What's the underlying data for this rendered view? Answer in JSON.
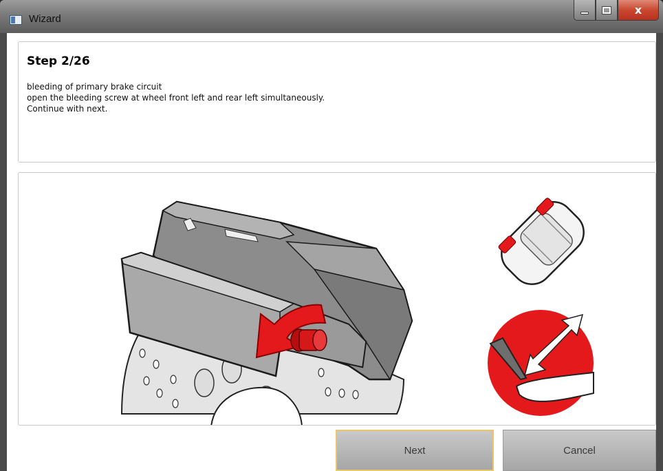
{
  "window": {
    "title": "Wizard",
    "close_glyph": "x",
    "icons": [
      "app-icon",
      "minimize-icon",
      "maximize-icon",
      "close-icon"
    ]
  },
  "step": {
    "title": "Step 2/26",
    "lines": [
      "bleeding of primary brake circuit",
      "open the bleeding screw at wheel front left and rear left simultaneously.",
      "Continue with next."
    ]
  },
  "illustration": {
    "items": [
      "brake-caliper",
      "brake-disc",
      "bleeding-screw",
      "rotate-arrow",
      "car-top-view",
      "pedal-icon"
    ],
    "highlight_color": "#e3191b"
  },
  "buttons": {
    "next_label": "Next",
    "cancel_label": "Cancel"
  }
}
